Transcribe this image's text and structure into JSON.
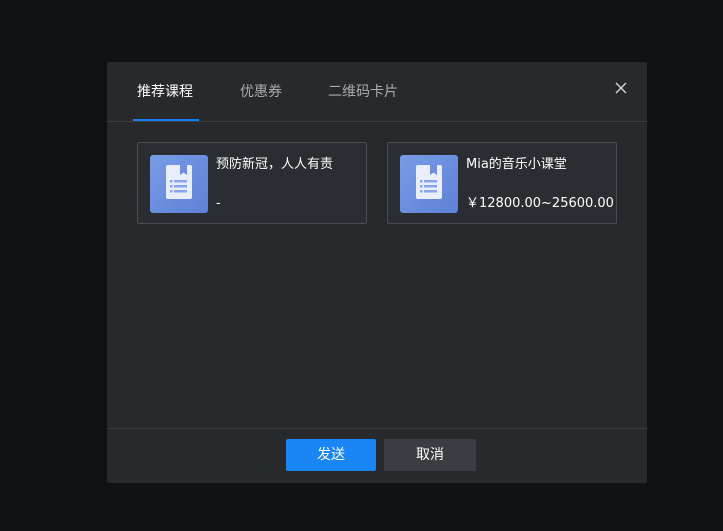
{
  "dialog": {
    "tabs": [
      {
        "label": "推荐课程",
        "active": true
      },
      {
        "label": "优惠券",
        "active": false
      },
      {
        "label": "二维码卡片",
        "active": false
      }
    ],
    "close_icon": "close-icon",
    "courses": [
      {
        "title": "预防新冠，人人有责",
        "price": "-",
        "thumb_icon": "document-icon"
      },
      {
        "title": "Mia的音乐小课堂",
        "price": "￥12800.00~25600.00",
        "thumb_icon": "document-icon"
      }
    ],
    "footer": {
      "send_label": "发送",
      "cancel_label": "取消"
    }
  },
  "colors": {
    "accent": "#1a85f5",
    "dialog_bg": "#27292c",
    "page_bg": "#111214"
  }
}
